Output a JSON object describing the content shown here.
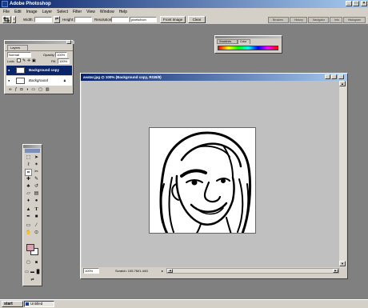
{
  "app": {
    "title": "Adobe Photoshop",
    "window_buttons": [
      "_",
      "□",
      "×"
    ]
  },
  "menu": [
    "File",
    "Edit",
    "Image",
    "Layer",
    "Select",
    "Filter",
    "View",
    "Window",
    "Help"
  ],
  "options_bar": {
    "width_label": "Width:",
    "height_label": "Height:",
    "resolution_label": "Resolution:",
    "resolution_unit": "pixels/inch",
    "front_image_label": "Front Image",
    "clear_label": "Clear",
    "palette_well_tabs": [
      "Brushes",
      "History",
      "Navigator",
      "Info",
      "Histogram"
    ]
  },
  "layers_palette": {
    "tab_label": "Layers",
    "blend_mode": "Normal",
    "opacity_label": "Opacity:",
    "opacity_value": "100%",
    "lock_label": "Lock:",
    "fill_label": "Fill:",
    "fill_value": "100%",
    "layers": [
      {
        "name": "Background copy",
        "selected": true
      },
      {
        "name": "Background",
        "selected": false
      }
    ]
  },
  "color_palette": {
    "tabs": [
      "Swatches",
      "Color"
    ]
  },
  "document": {
    "title": "avatar.jpg @ 100% (Background copy, RGB/8)",
    "zoom": "100%",
    "status": "Scratch: 105.7M/1.44G"
  },
  "taskbar": {
    "start_label": "start",
    "task_label": "Untitled"
  },
  "colors": {
    "title_active": "#0a246a",
    "chrome": "#d4d0c8",
    "workspace": "#808080",
    "foreground_swatch": "#d8a0b0",
    "background_swatch": "#ffffff"
  }
}
